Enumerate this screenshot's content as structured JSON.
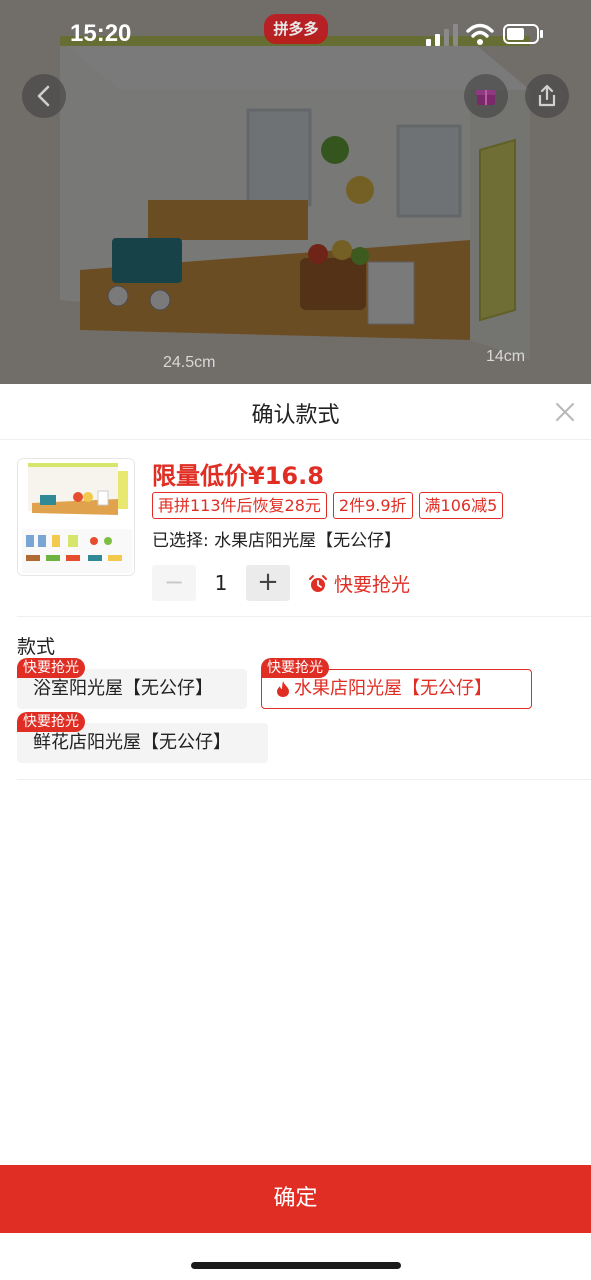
{
  "status_bar": {
    "time": "15:20"
  },
  "backdrop": {
    "brand": "拼多多",
    "dimension_width": "24.5cm",
    "dimension_depth": "14cm"
  },
  "sheet": {
    "title": "确认款式",
    "price": "限量低价¥16.8",
    "tags": [
      "再拼113件后恢复28元",
      "2件9.9折",
      "满106减5"
    ],
    "selected_text": "已选择: 水果店阳光屋【无公仔】",
    "quantity": "1",
    "minus_label": "−",
    "plus_label": "+",
    "hurry_text": "快要抢光",
    "section_label": "款式",
    "options": [
      {
        "label": "浴室阳光屋【无公仔】",
        "badge": "快要抢光",
        "selected": false
      },
      {
        "label": "水果店阳光屋【无公仔】",
        "badge": "快要抢光",
        "selected": true
      },
      {
        "label": "鲜花店阳光屋【无公仔】",
        "badge": "快要抢光",
        "selected": false
      }
    ],
    "confirm_label": "确定"
  },
  "colors": {
    "accent": "#e02e24",
    "option_bg": "#f4f4f4"
  },
  "icons": {
    "back": "chevron-left-icon",
    "share": "share-icon",
    "close": "close-icon",
    "alarm": "alarm-clock-icon",
    "flame": "flame-icon"
  }
}
